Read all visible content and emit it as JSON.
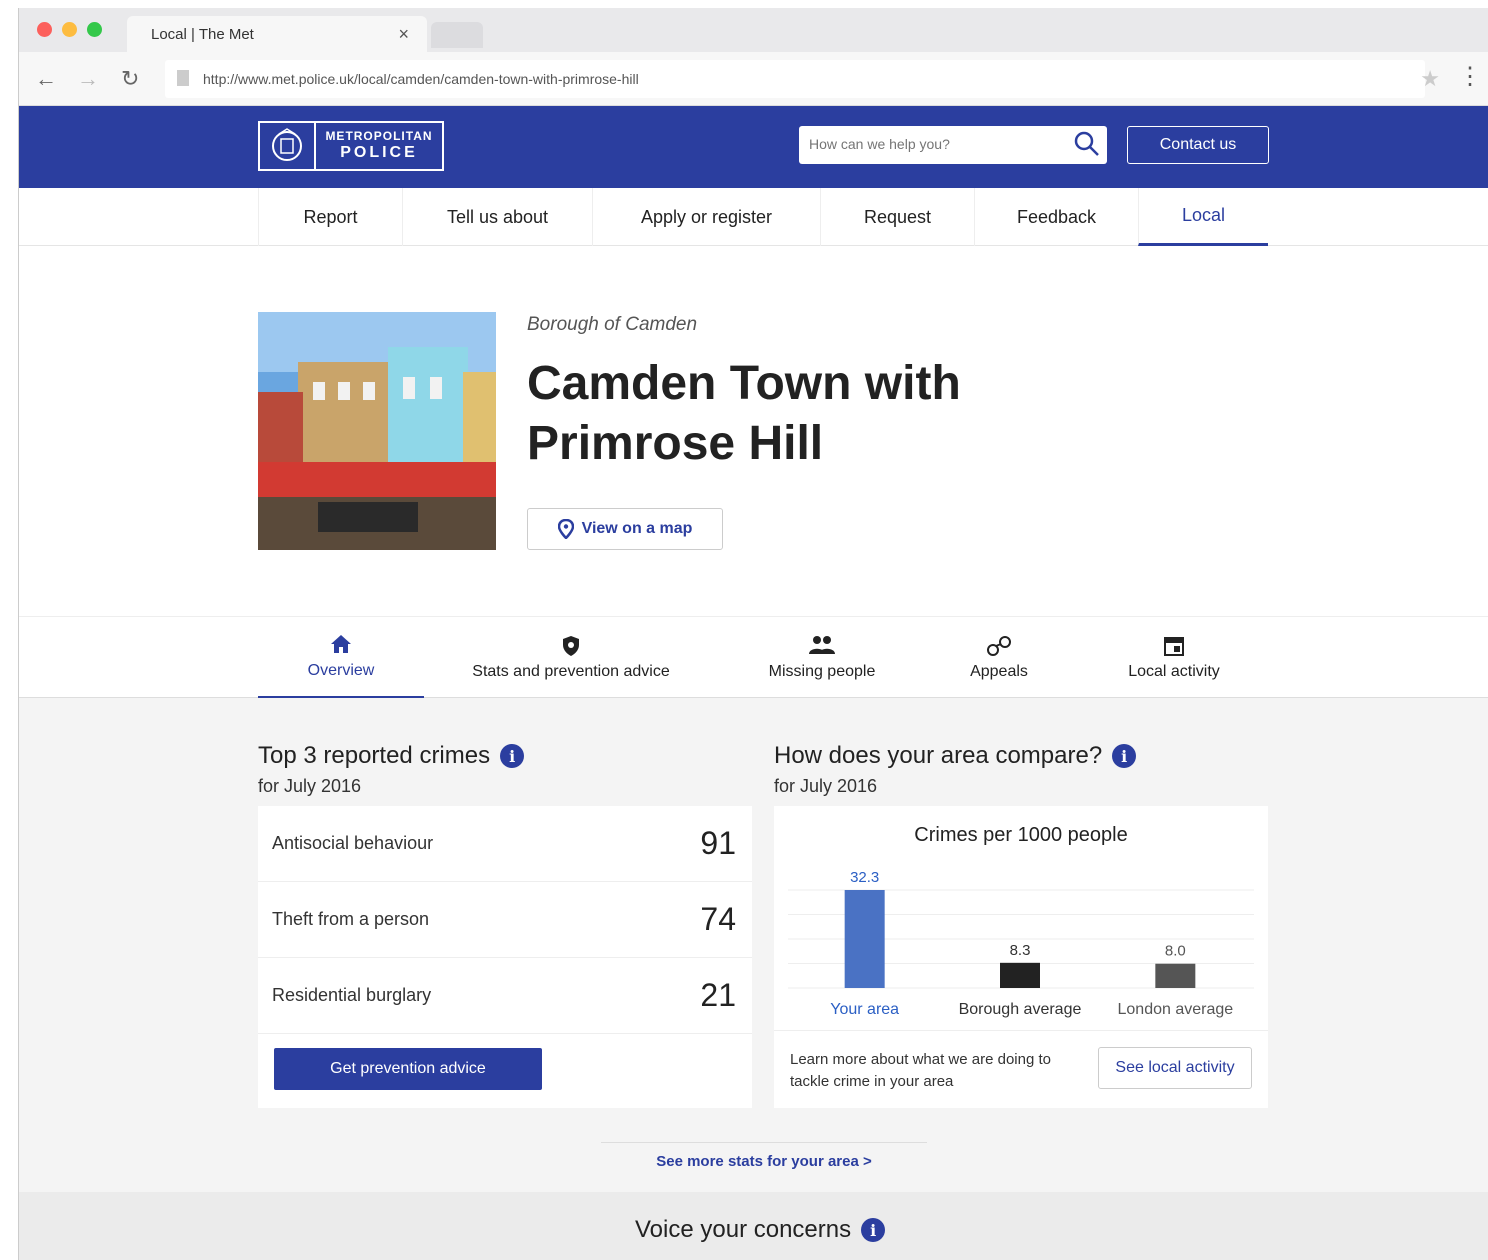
{
  "browser": {
    "tab_title": "Local | The Met",
    "tab_close": "×",
    "url": "http://www.met.police.uk/local/camden/camden-town-with-primrose-hill"
  },
  "header": {
    "logo_line1": "METROPOLITAN",
    "logo_line2": "POLICE",
    "search_placeholder": "How can we help you?",
    "contact_label": "Contact us"
  },
  "main_nav": [
    {
      "label": "Report"
    },
    {
      "label": "Tell us about"
    },
    {
      "label": "Apply or register"
    },
    {
      "label": "Request"
    },
    {
      "label": "Feedback"
    },
    {
      "label": "Local",
      "active": true
    }
  ],
  "hero": {
    "borough": "Borough of Camden",
    "title_line1": "Camden Town with",
    "title_line2": "Primrose Hill",
    "map_button": "View on a map"
  },
  "sub_nav": [
    {
      "label": "Overview",
      "icon": "home-icon",
      "active": true
    },
    {
      "label": "Stats and prevention advice",
      "icon": "shield-icon"
    },
    {
      "label": "Missing people",
      "icon": "people-icon"
    },
    {
      "label": "Appeals",
      "icon": "handcuffs-icon"
    },
    {
      "label": "Local activity",
      "icon": "calendar-icon"
    }
  ],
  "top_crimes": {
    "heading": "Top 3 reported crimes",
    "period": "for July 2016",
    "rows": [
      {
        "name": "Antisocial behaviour",
        "value": "91"
      },
      {
        "name": "Theft from a person",
        "value": "74"
      },
      {
        "name": "Residential burglary",
        "value": "21"
      }
    ],
    "button": "Get prevention advice"
  },
  "compare": {
    "heading": "How does your area compare?",
    "period": "for July 2016",
    "footer_text": "Learn more about what we are doing to tackle crime in your area",
    "button": "See local activity"
  },
  "chart_data": {
    "type": "bar",
    "title": "Crimes per 1000 people",
    "categories": [
      "Your area",
      "Borough average",
      "London average"
    ],
    "values": [
      32.3,
      8.3,
      8.0
    ],
    "value_labels": [
      "32.3",
      "8.3",
      "8.0"
    ],
    "colors": [
      "#4a72c4",
      "#222222",
      "#555555"
    ],
    "label_colors": [
      "#2b5fc4",
      "#333333",
      "#555555"
    ],
    "grid": true
  },
  "more_stats": "See more stats for your area >",
  "voice": {
    "heading": "Voice your concerns"
  },
  "colors": {
    "brand": "#2b3e9f",
    "background_band": "#f4f4f4"
  }
}
